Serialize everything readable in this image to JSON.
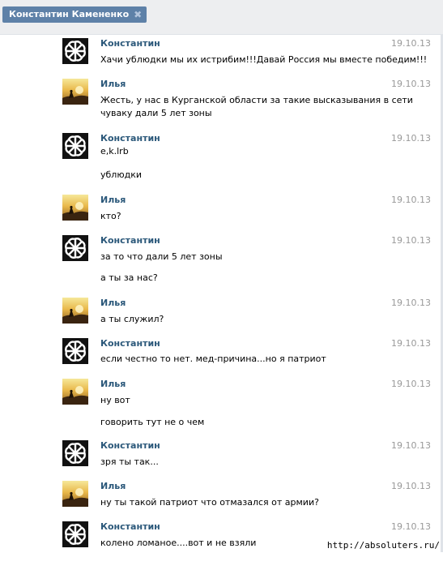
{
  "header": {
    "peer_name": "Константин Камененко",
    "close_symbol": "✖"
  },
  "watermark": "http://absoluters.ru/",
  "messages": [
    {
      "author": "Константин",
      "avatar": "solar-symbol-icon",
      "date": "19.10.13",
      "lines": [
        "Хачи ублюдки мы их истрибим!!!Давай Россия мы вместе победим!!!"
      ]
    },
    {
      "author": "Илья",
      "avatar": "sunset-photo-icon",
      "date": "19.10.13",
      "lines": [
        "Жесть, у нас в Курганской области за такие высказывания в сети",
        "чуваку дали 5 лет зоны"
      ]
    },
    {
      "author": "Константин",
      "avatar": "solar-symbol-icon",
      "date": "19.10.13",
      "lines": [
        "e,k.lrb",
        "ублюдки"
      ]
    },
    {
      "author": "Илья",
      "avatar": "sunset-photo-icon",
      "date": "19.10.13",
      "lines": [
        "кто?"
      ]
    },
    {
      "author": "Константин",
      "avatar": "solar-symbol-icon",
      "date": "19.10.13",
      "lines": [
        "за то что дали 5 лет зоны",
        "а ты за нас?"
      ]
    },
    {
      "author": "Илья",
      "avatar": "sunset-photo-icon",
      "date": "19.10.13",
      "lines": [
        "а ты служил?"
      ]
    },
    {
      "author": "Константин",
      "avatar": "solar-symbol-icon",
      "date": "19.10.13",
      "lines": [
        "если честно то нет. мед-причина...но я патриот"
      ]
    },
    {
      "author": "Илья",
      "avatar": "sunset-photo-icon",
      "date": "19.10.13",
      "lines": [
        "ну вот",
        "говорить тут не о чем"
      ]
    },
    {
      "author": "Константин",
      "avatar": "solar-symbol-icon",
      "date": "19.10.13",
      "lines": [
        "зря ты так..."
      ]
    },
    {
      "author": "Илья",
      "avatar": "sunset-photo-icon",
      "date": "19.10.13",
      "lines": [
        "ну ты такой патриот что отмазался от армии?"
      ]
    },
    {
      "author": "Константин",
      "avatar": "solar-symbol-icon",
      "date": "19.10.13",
      "lines": [
        "колено ломаное....вот и не взяли"
      ]
    }
  ]
}
